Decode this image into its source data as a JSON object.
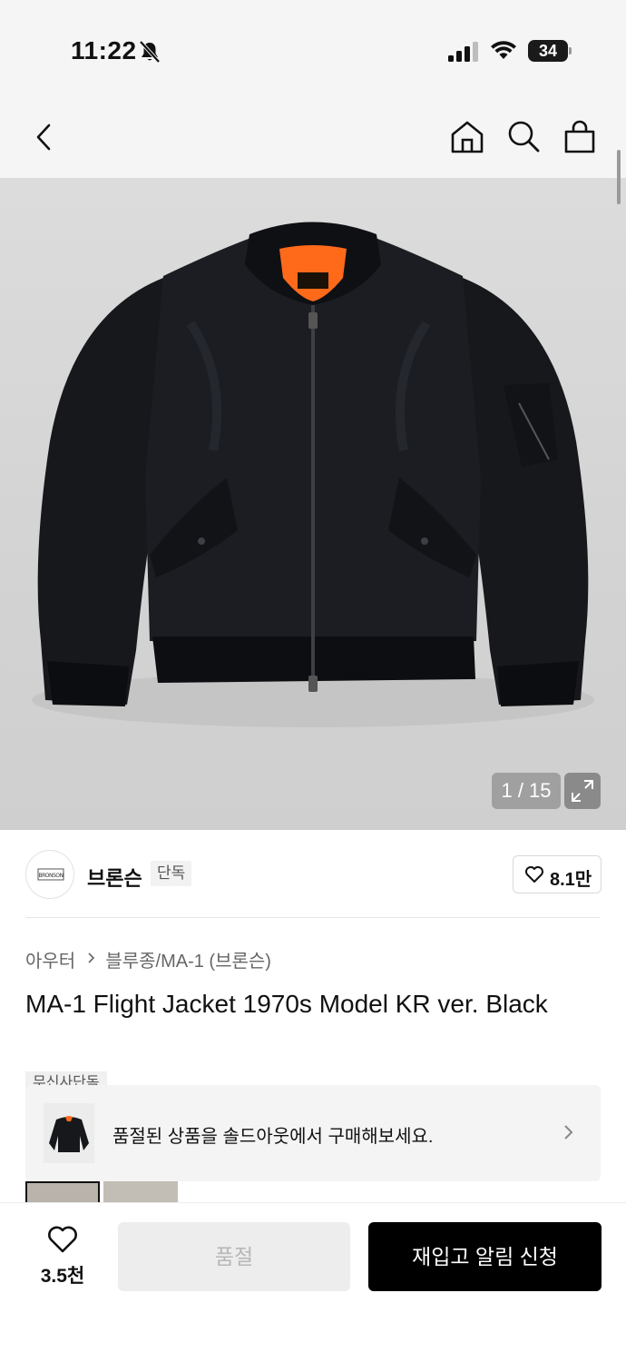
{
  "status": {
    "time": "11:22",
    "battery": "34",
    "icons": [
      "bell-off-icon",
      "signal-icon",
      "wifi-icon",
      "battery-icon"
    ]
  },
  "nav": {
    "icons": [
      "back-arrow-icon",
      "home-icon",
      "search-icon",
      "shopping-bag-icon"
    ]
  },
  "gallery": {
    "counter": "1 / 15",
    "current": 1,
    "total": 15,
    "icons": [
      "expand-icon"
    ]
  },
  "brand": {
    "logo_text": "BRONSON",
    "name": "브론슨",
    "tag": "단독",
    "likes": "8.1만"
  },
  "product": {
    "breadcrumb": [
      "아우터",
      "블루종/MA-1 (브론슨)"
    ],
    "title": "MA-1 Flight Jacket 1970s Model KR ver. Black",
    "chip": "무신사단독"
  },
  "soldout_banner": {
    "text": "품절된 상품을 솔드아웃에서 구매해보세요."
  },
  "bottom": {
    "wish_count": "3.5천",
    "soldout_label": "품절",
    "restock_label": "재입고 알림 신청"
  },
  "colors": {
    "accent": "#000000",
    "disabled_bg": "#ededed",
    "disabled_text": "#b7b7b7",
    "lining_orange": "#ff6a1a"
  }
}
